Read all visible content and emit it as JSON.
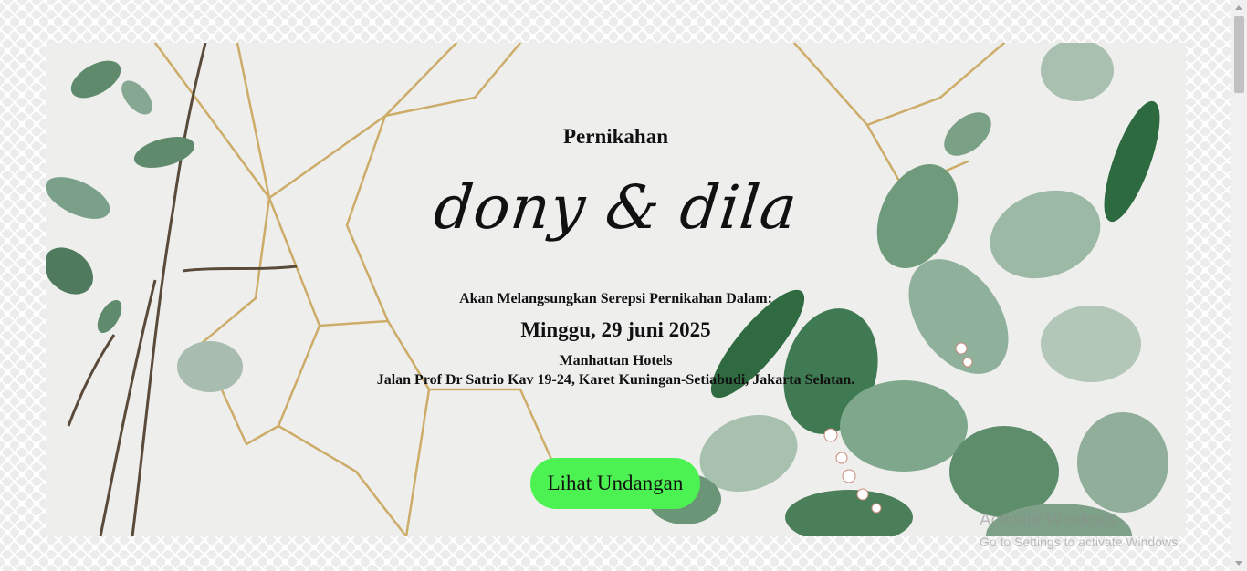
{
  "hero": {
    "eyebrow": "Pernikahan",
    "couple_names": "dony & dila",
    "announcement": "Akan Melangsungkan Serepsi Pernikahan Dalam:",
    "date": "Minggu, 29 juni 2025",
    "venue": "Manhattan Hotels",
    "address": "Jalan Prof Dr Satrio Kav 19-24, Karet Kuningan-Setiabudi, Jakarta Selatan.",
    "cta_label": "Lihat Undangan"
  },
  "colors": {
    "cta_background": "#4cf251",
    "hero_background": "#eeeeed",
    "leaf_green": "#5f8a6c",
    "gold_wire": "#c9a55a"
  },
  "watermark": {
    "title": "Activate Windows",
    "subtitle": "Go to Settings to activate Windows."
  }
}
